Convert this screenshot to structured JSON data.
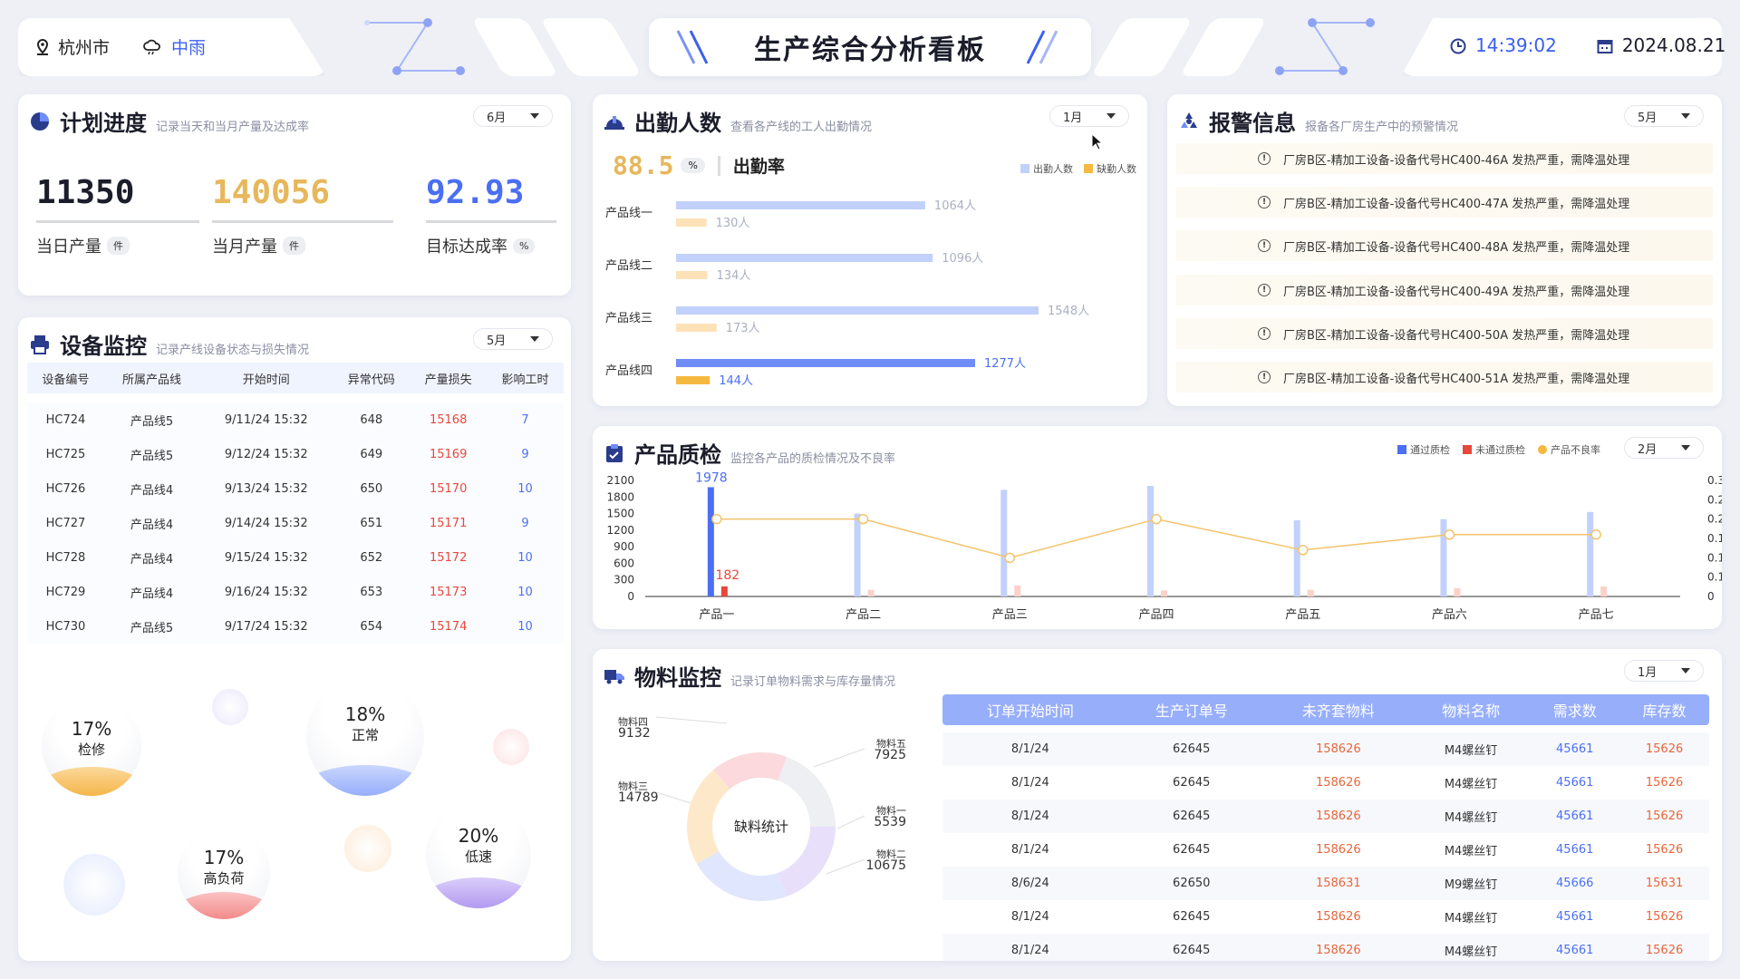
{
  "header": {
    "city": "杭州市",
    "weather": "中雨",
    "title": "生产综合分析看板",
    "time": "14:39:02",
    "date": "2024.08.21"
  },
  "colors": {
    "blue": "#4b6ff3",
    "orange": "#e7b75b",
    "red": "#e8473b",
    "lightblue": "#c2d1fb",
    "lightorange": "#fde2b8"
  },
  "plan": {
    "title": "计划进度",
    "subtitle": "记录当天和当月产量及达成率",
    "month": "6月",
    "stats": [
      {
        "value": "11350",
        "label": "当日产量",
        "unit": "件",
        "color": "#1b1d2b"
      },
      {
        "value": "140056",
        "label": "当月产量",
        "unit": "件",
        "color": "#e7b75b"
      },
      {
        "value": "92.93",
        "label": "目标达成率",
        "unit": "%",
        "color": "#4b6ff3"
      }
    ]
  },
  "attendance": {
    "title": "出勤人数",
    "subtitle": "查看各产线的工人出勤情况",
    "month": "1月",
    "rate_value": "88.5",
    "rate_unit": "%",
    "rate_label": "出勤率",
    "legend": [
      "出勤人数",
      "缺勤人数"
    ],
    "rows": [
      {
        "name": "产品线一",
        "present": 1064,
        "present_label": "1064人",
        "absent": 130,
        "absent_label": "130人"
      },
      {
        "name": "产品线二",
        "present": 1096,
        "present_label": "1096人",
        "absent": 134,
        "absent_label": "134人"
      },
      {
        "name": "产品线三",
        "present": 1548,
        "present_label": "1548人",
        "absent": 173,
        "absent_label": "173人"
      },
      {
        "name": "产品线四",
        "present": 1277,
        "present_label": "1277人",
        "absent": 144,
        "absent_label": "144人"
      }
    ]
  },
  "alarms": {
    "title": "报警信息",
    "subtitle": "报备各厂房生产中的预警情况",
    "month": "5月",
    "items": [
      "厂房B区-精加工设备-设备代号HC400-46A 发热严重，需降温处理",
      "厂房B区-精加工设备-设备代号HC400-47A 发热严重，需降温处理",
      "厂房B区-精加工设备-设备代号HC400-48A 发热严重，需降温处理",
      "厂房B区-精加工设备-设备代号HC400-49A 发热严重，需降温处理",
      "厂房B区-精加工设备-设备代号HC400-50A 发热严重，需降温处理",
      "厂房B区-精加工设备-设备代号HC400-51A 发热严重，需降温处理"
    ]
  },
  "devices": {
    "title": "设备监控",
    "subtitle": "记录产线设备状态与损失情况",
    "month": "5月",
    "columns": [
      "设备编号",
      "所属产品线",
      "开始时间",
      "异常代码",
      "产量损失",
      "影响工时"
    ],
    "rows": [
      [
        "HC724",
        "产品线5",
        "9/11/24 15:32",
        "648",
        "15168",
        "7"
      ],
      [
        "HC725",
        "产品线5",
        "9/12/24 15:32",
        "649",
        "15169",
        "9"
      ],
      [
        "HC726",
        "产品线4",
        "9/13/24 15:32",
        "650",
        "15170",
        "10"
      ],
      [
        "HC727",
        "产品线4",
        "9/14/24 15:32",
        "651",
        "15171",
        "9"
      ],
      [
        "HC728",
        "产品线4",
        "9/15/24 15:32",
        "652",
        "15172",
        "10"
      ],
      [
        "HC729",
        "产品线4",
        "9/16/24 15:32",
        "653",
        "15173",
        "10"
      ],
      [
        "HC730",
        "产品线5",
        "9/17/24 15:32",
        "654",
        "15174",
        "10"
      ]
    ],
    "bubbles": [
      {
        "pct": "17%",
        "label": "检修",
        "color": "#f5c06a"
      },
      {
        "pct": "18%",
        "label": "正常",
        "color": "#a8bcf8"
      },
      {
        "pct": "17%",
        "label": "高负荷",
        "color": "#f6a5a5"
      },
      {
        "pct": "20%",
        "label": "低速",
        "color": "#c3b0f0"
      }
    ]
  },
  "quality": {
    "title": "产品质检",
    "subtitle": "监控各产品的质检情况及不良率",
    "month": "2月",
    "legend": [
      "通过质检",
      "未通过质检",
      "产品不良率"
    ]
  },
  "chart_data": {
    "type": "bar",
    "categories": [
      "产品一",
      "产品二",
      "产品三",
      "产品四",
      "产品五",
      "产品六",
      "产品七"
    ],
    "series": [
      {
        "name": "通过质检",
        "values": [
          1978,
          1500,
          1930,
          2000,
          1380,
          1400,
          1530
        ]
      },
      {
        "name": "未通过质检",
        "values": [
          182,
          120,
          200,
          110,
          120,
          150,
          180
        ]
      },
      {
        "name": "产品不良率",
        "type": "line",
        "axis": "right",
        "values": [
          0.2,
          0.2,
          0.1,
          0.2,
          0.12,
          0.16,
          0.16
        ]
      }
    ],
    "data_labels": [
      "1978",
      "182"
    ],
    "y_ticks": [
      "0",
      "300",
      "600",
      "900",
      "1200",
      "1500",
      "1800",
      "2100"
    ],
    "y2_ticks": [
      "0",
      "0.1",
      "0.1",
      "0.1",
      "0.2",
      "0.2",
      "0.3"
    ],
    "ylim": [
      0,
      2100
    ],
    "y2lim": [
      0,
      0.3
    ]
  },
  "materials": {
    "title": "物料监控",
    "subtitle": "记录订单物料需求与库存量情况",
    "month": "1月",
    "donut_center": "缺料统计",
    "donut": [
      {
        "name": "物料一",
        "value": "5539",
        "color": "#e8e0fa"
      },
      {
        "name": "物料二",
        "value": "10675",
        "color": "#dfe6fd"
      },
      {
        "name": "物料三",
        "value": "14789",
        "color": "#fde9c9"
      },
      {
        "name": "物料四",
        "value": "9132",
        "color": "#fbd9dd"
      },
      {
        "name": "物料五",
        "value": "7925",
        "color": "#eeeff3"
      }
    ],
    "columns": [
      "订单开始时间",
      "生产订单号",
      "未齐套物料",
      "物料名称",
      "需求数",
      "库存数"
    ],
    "rows": [
      [
        "8/1/24",
        "62645",
        "158626",
        "M4螺丝钉",
        "45661",
        "15626"
      ],
      [
        "8/1/24",
        "62645",
        "158626",
        "M4螺丝钉",
        "45661",
        "15626"
      ],
      [
        "8/1/24",
        "62645",
        "158626",
        "M4螺丝钉",
        "45661",
        "15626"
      ],
      [
        "8/1/24",
        "62645",
        "158626",
        "M4螺丝钉",
        "45661",
        "15626"
      ],
      [
        "8/6/24",
        "62650",
        "158631",
        "M9螺丝钉",
        "45666",
        "15631"
      ],
      [
        "8/1/24",
        "62645",
        "158626",
        "M4螺丝钉",
        "45661",
        "15626"
      ],
      [
        "8/1/24",
        "62645",
        "158626",
        "M4螺丝钉",
        "45661",
        "15626"
      ]
    ]
  }
}
